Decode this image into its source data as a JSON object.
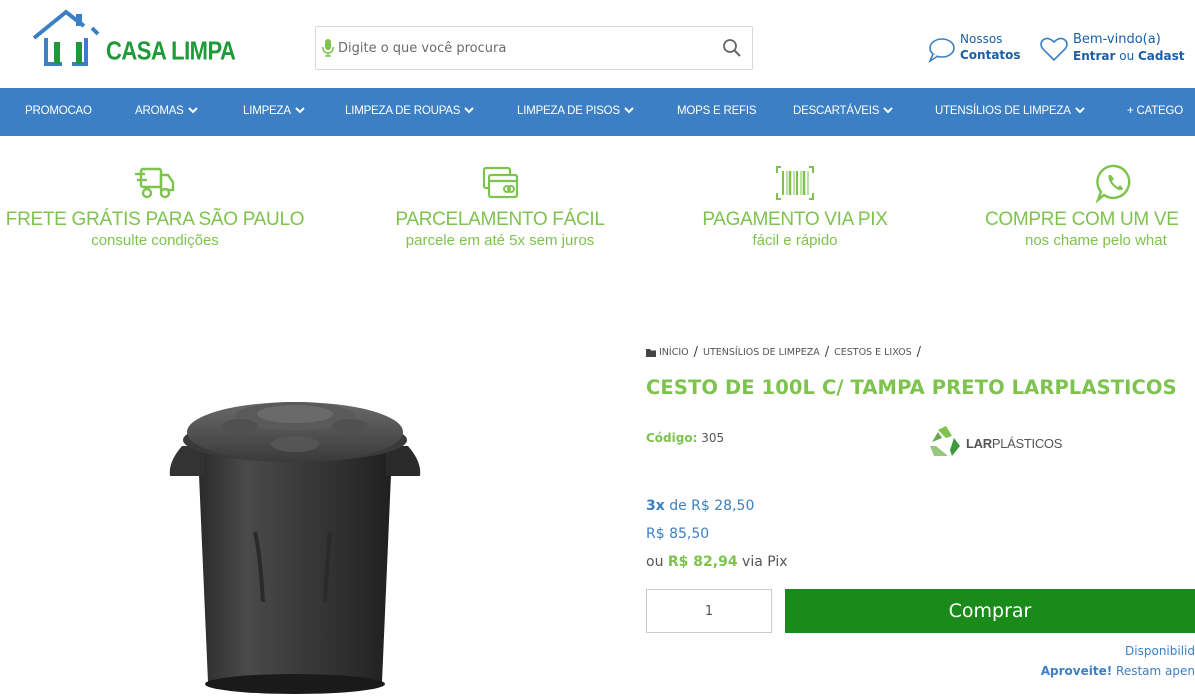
{
  "header": {
    "logo_text": "CASA LIMPA",
    "search_placeholder": "Digite o que você procura",
    "contacts_line1": "Nossos",
    "contacts_line2": "Contatos",
    "account_line1": "Bem-vindo(a)",
    "account_login": "Entrar",
    "account_or": " ou ",
    "account_register": "Cadast"
  },
  "nav": {
    "items": [
      {
        "label": "PROMOCAO"
      },
      {
        "label": "AROMAS"
      },
      {
        "label": "LIMPEZA"
      },
      {
        "label": "LIMPEZA DE ROUPAS"
      },
      {
        "label": "LIMPEZA DE PISOS"
      },
      {
        "label": "MOPS E REFIS"
      },
      {
        "label": "DESCARTÁVEIS"
      },
      {
        "label": "UTENSÍLIOS DE LIMPEZA"
      },
      {
        "label": "+ CATEGO"
      }
    ]
  },
  "benefits": [
    {
      "title": "FRETE GRÁTIS PARA SÃO PAULO",
      "sub": "consulte condições",
      "icon": "truck-icon"
    },
    {
      "title": "PARCELAMENTO FÁCIL",
      "sub": "parcele em até  5x sem juros",
      "icon": "credit-card-icon"
    },
    {
      "title": "PAGAMENTO VIA PIX",
      "sub": "fácil e rápido",
      "icon": "barcode-icon"
    },
    {
      "title": "COMPRE COM UM VE",
      "sub": "nos chame pelo what",
      "icon": "whatsapp-icon"
    }
  ],
  "breadcrumb": {
    "items": [
      "INÍCIO",
      "UTENSÍLIOS DE LIMPEZA",
      "CESTOS E LIXOS"
    ],
    "separator": "/"
  },
  "product": {
    "title": "CESTO DE 100L C/ TAMPA PRETO LARPLASTICOS",
    "code_label": "Código:",
    "code_value": "305",
    "brand_bold": "LAR",
    "brand_rest": "PLÁSTICOS",
    "installments_count": "3x",
    "installments_text": " de R$ 28,50",
    "price": "R$ 85,50",
    "pix_prefix": "ou ",
    "pix_price": "R$ 82,94",
    "pix_suffix": " via Pix",
    "quantity": "1",
    "buy_label": "Comprar",
    "availability": "Disponibilid",
    "promo_bold": "Aproveite!",
    "promo_text": " Restam apen"
  },
  "colors": {
    "green": "#7dc34e",
    "blue": "#3d7fc4",
    "buy": "#1a8a1a"
  }
}
